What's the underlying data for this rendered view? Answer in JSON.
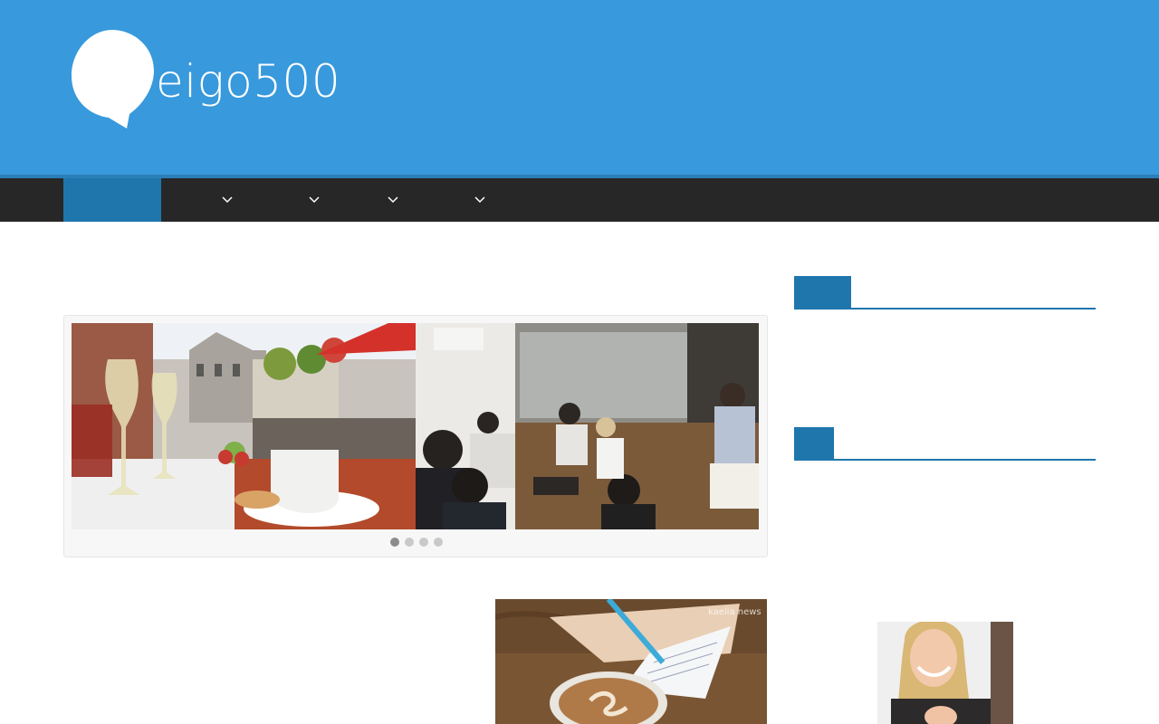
{
  "site": {
    "logo_text": "eigo500",
    "header_color": "#3899dc",
    "nav_color": "#272728",
    "accent_color": "#1f76ad"
  },
  "nav": {
    "items": [
      {
        "has_submenu": false,
        "active": true
      },
      {
        "has_submenu": true,
        "icon": "chevron-down-icon"
      },
      {
        "has_submenu": true,
        "icon": "chevron-down-icon"
      },
      {
        "has_submenu": true,
        "icon": "chevron-down-icon"
      },
      {
        "has_submenu": true,
        "icon": "chevron-down-icon"
      }
    ]
  },
  "slider": {
    "slides": [
      {
        "image": "outdoor-cafe-terrace-photo"
      },
      {
        "image": "people-chatting-in-cafe-photo"
      }
    ],
    "dots": 4,
    "active_dot": 1
  },
  "post": {
    "image": "coffee-cup-writing-notes-photo",
    "watermark": "kaelia news"
  },
  "sidebar": {
    "widgets": [
      {
        "title": ""
      },
      {
        "title": ""
      }
    ],
    "image": "smiling-woman-photo"
  }
}
